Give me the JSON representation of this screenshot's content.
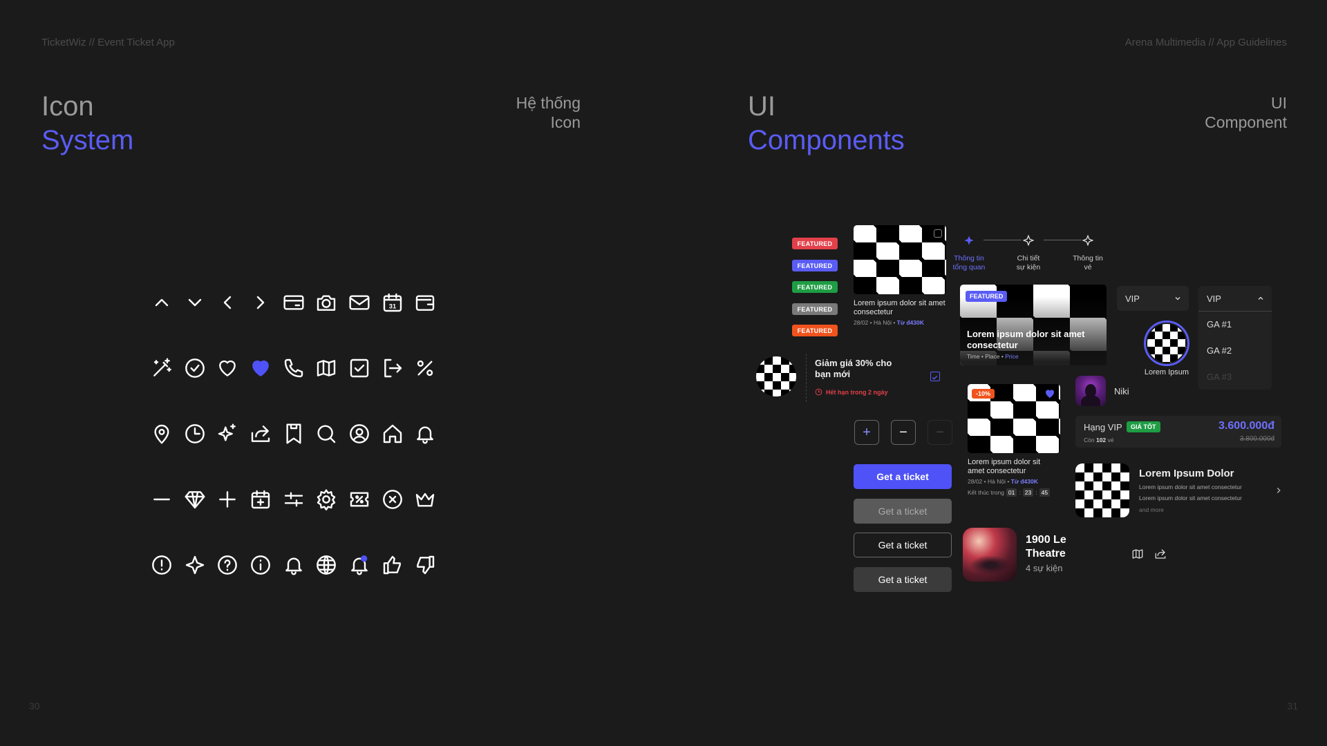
{
  "header": {
    "left_meta": "TicketWiz // Event Ticket App",
    "right_meta": "Arena Multimedia // App Guidelines"
  },
  "left_section": {
    "title_line1": "Icon",
    "title_line2": "System",
    "subtitle_line1": "Hệ thống",
    "subtitle_line2": "Icon",
    "page_number": "30"
  },
  "right_section": {
    "title_line1": "UI",
    "title_line2": "Components",
    "subtitle_line1": "UI",
    "subtitle_line2": "Component",
    "page_number": "31"
  },
  "icons": [
    [
      "chevron-up-icon",
      "chevron-down-icon",
      "chevron-left-icon",
      "chevron-right-icon",
      "credit-card-icon",
      "camera-icon",
      "mail-icon",
      "calendar-31-icon",
      "wallet-icon"
    ],
    [
      "magic-wand-icon",
      "check-circle-icon",
      "heart-icon",
      "heart-filled-icon",
      "phone-icon",
      "map-icon",
      "checkbox-icon",
      "logout-icon",
      "percent-icon"
    ],
    [
      "location-pin-icon",
      "clock-icon",
      "sparkle-icon",
      "share-icon",
      "bookmark-icon",
      "search-icon",
      "user-circle-icon",
      "home-icon",
      "bell-icon"
    ],
    [
      "minus-icon",
      "diamond-icon",
      "plus-icon",
      "calendar-add-icon",
      "sliders-icon",
      "gear-icon",
      "ticket-percent-icon",
      "close-circle-icon",
      "crown-icon"
    ],
    [
      "alert-circle-icon",
      "star-outline-icon",
      "help-circle-icon",
      "info-circle-icon",
      "bell-outline-icon",
      "globe-icon",
      "bell-dot-icon",
      "thumbs-up-icon",
      "thumbs-down-icon"
    ]
  ],
  "colors": {
    "accent": "#5a5cf4",
    "background": "#1b1b1b",
    "badge_red": "#e2404a",
    "badge_blue": "#5a5cf4",
    "badge_green": "#1f9d45",
    "badge_grey": "#7a7a7a",
    "badge_orange": "#f0531d",
    "good_price_green": "#1f9d45"
  },
  "badges": [
    "FEATURED",
    "FEATURED",
    "FEATURED",
    "FEATURED",
    "FEATURED"
  ],
  "card1": {
    "title": "Lorem ipsum dolor sit amet consectetur",
    "meta_prefix": "28/02 • Hà Nội • ",
    "price": "Từ đ430K"
  },
  "promo": {
    "title": "Giảm giá 30% cho bạn mới",
    "expiry": "Hết hạn trong 2 ngày"
  },
  "stepper": {
    "plus": "+",
    "minus": "−",
    "disabled": "−"
  },
  "buttons": [
    "Get a ticket",
    "Get a ticket",
    "Get a ticket",
    "Get a ticket"
  ],
  "steps": [
    {
      "line1": "Thông tin",
      "line2": "tổng quan"
    },
    {
      "line1": "Chi tiết",
      "line2": "sự kiện"
    },
    {
      "line1": "Thông tin",
      "line2": "vé"
    }
  ],
  "featured_banner": {
    "badge": "FEATURED",
    "title": "Lorem ipsum dolor sit amet consectetur",
    "meta_prefix": "Time • Place • ",
    "meta_price": "Price"
  },
  "card2": {
    "discount": "-10%",
    "title": "Lorem ipsum dolor sit amet consectetur",
    "meta_prefix": "28/02 • Hà Nội • ",
    "price": "Từ đ430K",
    "countdown_label": "Kết thúc trong",
    "h": "01",
    "m": "23",
    "s": "45"
  },
  "venue": {
    "name": "1900 Le Theatre",
    "events": "4 sự kiện"
  },
  "dropdown_closed": {
    "value": "VIP"
  },
  "dropdown_open": {
    "value": "VIP",
    "options": [
      "GA #1",
      "GA #2",
      "GA #3"
    ]
  },
  "avatar_large": {
    "label": "Lorem Ipsum"
  },
  "artist": {
    "name": "Niki"
  },
  "ticket_tier": {
    "name": "Hạng VIP",
    "tag": "GIÁ TỐT",
    "remaining_prefix": "Còn ",
    "remaining_count": "102",
    "remaining_suffix": " vé",
    "price": "3.600.000đ",
    "old_price": "3.800.000đ"
  },
  "list_item": {
    "title": "Lorem Ipsum Dolor",
    "line1": "Lorem ipsum dolor sit amet consectetur",
    "line2": "Lorem ipsum dolor sit amet consectetur",
    "more": "and more"
  }
}
